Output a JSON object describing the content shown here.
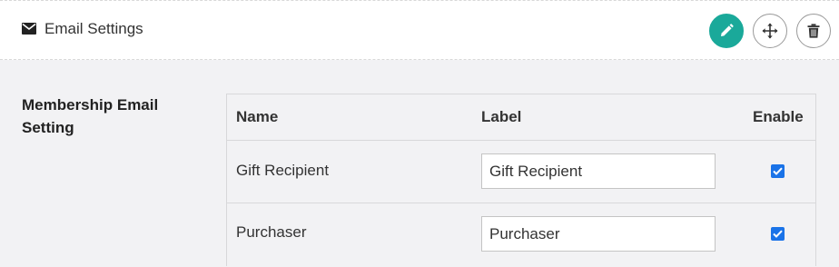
{
  "header": {
    "title": "Email Settings",
    "icons": {
      "title_icon": "envelope-icon",
      "edit": "pencil-icon",
      "move": "move-arrows-icon",
      "delete": "trash-icon"
    },
    "edit_color": "#1aa99a"
  },
  "section": {
    "label": "Membership Email Setting"
  },
  "table": {
    "columns": [
      "Name",
      "Label",
      "Enable"
    ],
    "rows": [
      {
        "name": "Gift Recipient",
        "label": "Gift Recipient",
        "enabled": true
      },
      {
        "name": "Purchaser",
        "label": "Purchaser",
        "enabled": true
      }
    ]
  },
  "colors": {
    "checkbox": "#1a73e8"
  }
}
